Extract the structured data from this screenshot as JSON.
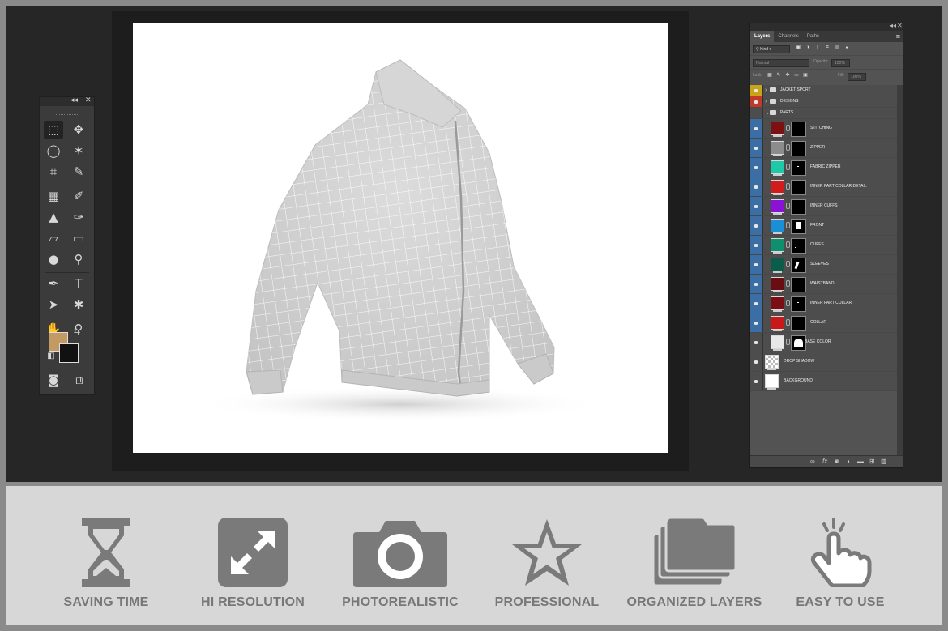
{
  "tools_panel": {
    "collapse_glyph": "◂◂",
    "close_glyph": "✕",
    "tools": [
      {
        "name": "rectangular-marquee-icon",
        "glyph": "⬚"
      },
      {
        "name": "move-icon",
        "glyph": "✥"
      },
      {
        "name": "lasso-icon",
        "glyph": "◯"
      },
      {
        "name": "magic-wand-icon",
        "glyph": "✶"
      },
      {
        "name": "crop-icon",
        "glyph": "⌗"
      },
      {
        "name": "eyedropper-icon",
        "glyph": "✎"
      },
      {
        "name": "healing-brush-icon",
        "glyph": "▦"
      },
      {
        "name": "brush-icon",
        "glyph": "✐"
      },
      {
        "name": "clone-stamp-icon",
        "glyph": "▲"
      },
      {
        "name": "history-brush-icon",
        "glyph": "✑"
      },
      {
        "name": "eraser-icon",
        "glyph": "▱"
      },
      {
        "name": "gradient-icon",
        "glyph": "▭"
      },
      {
        "name": "blur-icon",
        "glyph": "●"
      },
      {
        "name": "dodge-icon",
        "glyph": "⚲"
      },
      {
        "name": "pen-icon",
        "glyph": "✒"
      },
      {
        "name": "type-icon",
        "glyph": "T"
      },
      {
        "name": "path-selection-icon",
        "glyph": "➤"
      },
      {
        "name": "custom-shape-icon",
        "glyph": "✱"
      },
      {
        "name": "hand-icon",
        "glyph": "✋"
      },
      {
        "name": "zoom-icon",
        "glyph": "⚲"
      },
      {
        "name": "quick-mask-icon",
        "glyph": "◙"
      },
      {
        "name": "screen-mode-icon",
        "glyph": "⧉"
      }
    ],
    "foreground_color": "#c49a64",
    "background_color": "#111111"
  },
  "layers_panel": {
    "tabs": [
      "Layers",
      "Channels",
      "Paths"
    ],
    "active_tab": "Layers",
    "filter_kind": "Kind",
    "blend_mode": "Normal",
    "opacity_label": "Opacity:",
    "opacity_value": "100%",
    "lock_label": "Lock:",
    "fill_label": "Fill:",
    "fill_value": "100%",
    "groups": [
      {
        "label": "JACKET SPORT",
        "eye": "yellow",
        "chev": "›"
      },
      {
        "label": "DESIGNS",
        "eye": "red",
        "chev": "›"
      },
      {
        "label": "PARTS",
        "eye": "plain",
        "chev": "⌄"
      }
    ],
    "layers": [
      {
        "label": "STITCHING",
        "color": "#7d1010",
        "eye": "blue",
        "mask": "none"
      },
      {
        "label": "ZIPPER",
        "color": "#8c8c8c",
        "eye": "blue",
        "mask": "none"
      },
      {
        "label": "FABRIC ZIPPER",
        "color": "#1dc9a6",
        "eye": "blue",
        "mask": "dot"
      },
      {
        "label": "INNER PART COLLAR DETAIL",
        "color": "#d21c1c",
        "eye": "blue",
        "mask": "none"
      },
      {
        "label": "INNER CUFFS",
        "color": "#8a12d6",
        "eye": "blue",
        "mask": "none"
      },
      {
        "label": "FRONT",
        "color": "#1a8fd6",
        "eye": "blue",
        "mask": "front"
      },
      {
        "label": "CUFFS",
        "color": "#0e8f6e",
        "eye": "blue",
        "mask": "dots"
      },
      {
        "label": "SLEEVES",
        "color": "#0c5c4c",
        "eye": "blue",
        "mask": "sleeve"
      },
      {
        "label": "WAISTBAND",
        "color": "#6a0d12",
        "eye": "blue",
        "mask": "line"
      },
      {
        "label": "INNER PART COLLAR",
        "color": "#7a0e14",
        "eye": "blue",
        "mask": "dot"
      },
      {
        "label": "COLLAR",
        "color": "#c81818",
        "eye": "blue",
        "mask": "dot"
      },
      {
        "label": "BASE COLOR",
        "color": "#e8e8e8",
        "eye": "plain",
        "mask": "jacket"
      },
      {
        "label": "DROP SHADOW",
        "color": "checker",
        "eye": "plain",
        "mask": "nomask"
      },
      {
        "label": "BACKGROUND",
        "color": "#ffffff",
        "eye": "plain",
        "mask": "nomask"
      }
    ]
  },
  "features": [
    {
      "label": "SAVING TIME",
      "icon": "hourglass-icon"
    },
    {
      "label": "HI RESOLUTION",
      "icon": "resize-arrows-icon"
    },
    {
      "label": "PHOTOREALISTIC",
      "icon": "camera-icon"
    },
    {
      "label": "PROFESSIONAL",
      "icon": "star-icon"
    },
    {
      "label": "ORGANIZED LAYERS",
      "icon": "folders-icon"
    },
    {
      "label": "EASY TO USE",
      "icon": "tap-hand-icon"
    }
  ]
}
